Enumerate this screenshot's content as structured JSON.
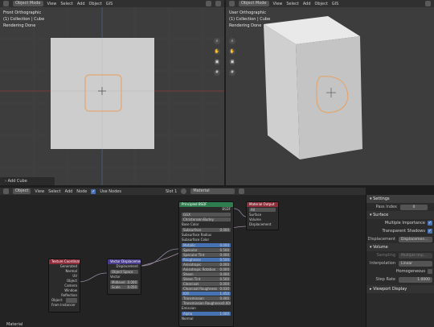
{
  "left_viewport": {
    "header": {
      "mode": "Object Mode",
      "menus": [
        "View",
        "Select",
        "Add",
        "Object",
        "GIS"
      ]
    },
    "info": [
      "Front Orthographic",
      "(1) Collection | Cube",
      "Rendering Done"
    ]
  },
  "right_viewport": {
    "header": {
      "mode": "Object Mode",
      "menus": [
        "View",
        "Select",
        "Add",
        "Object",
        "GIS"
      ]
    },
    "info": [
      "User Orthographic",
      "(1) Collection | Cube",
      "Rendering Done"
    ]
  },
  "operator_panel": {
    "label": "Add Cube"
  },
  "node_editor": {
    "header": {
      "object_mode": "Object",
      "menus": [
        "View",
        "Select",
        "Add",
        "Node"
      ],
      "use_nodes_label": "Use Nodes",
      "slot": "Slot 1",
      "material": "Material"
    },
    "material_label": "Material",
    "nodes": {
      "texcoord": {
        "title": "Texture Coordinate",
        "outputs": [
          "Generated",
          "Normal",
          "UV",
          "Object",
          "Camera",
          "Window",
          "Reflection"
        ],
        "object_label": "Object:",
        "from_instancer": "From Instancer"
      },
      "vector_disp": {
        "title": "Vector Displacement",
        "output": "Displacement",
        "space": "Object Space",
        "inputs": [
          "Vector"
        ],
        "midlevel_label": "Midlevel",
        "midlevel_value": "0.000",
        "scale_label": "Scale",
        "scale_value": "0.050"
      },
      "principled": {
        "title": "Principled BSDF",
        "output": "BSDF",
        "dist": "GGX",
        "sss": "Christensen-Burley",
        "rows": [
          {
            "label": "Base Color",
            "value": ""
          },
          {
            "label": "Subsurface",
            "value": "0.000"
          },
          {
            "label": "Subsurface Radius",
            "value": ""
          },
          {
            "label": "Subsurface Color",
            "value": ""
          },
          {
            "label": "Metallic",
            "value": "0.000"
          },
          {
            "label": "Specular",
            "value": "0.500"
          },
          {
            "label": "Specular Tint",
            "value": "0.000"
          },
          {
            "label": "Roughness",
            "value": "0.500"
          },
          {
            "label": "Anisotropic",
            "value": "0.000"
          },
          {
            "label": "Anisotropic Rotation",
            "value": "0.000"
          },
          {
            "label": "Sheen",
            "value": "0.000"
          },
          {
            "label": "Sheen Tint",
            "value": "0.500"
          },
          {
            "label": "Clearcoat",
            "value": "0.000"
          },
          {
            "label": "Clearcoat Roughness",
            "value": "0.030"
          },
          {
            "label": "IOR",
            "value": "1.450"
          },
          {
            "label": "Transmission",
            "value": "0.000"
          },
          {
            "label": "Transmission Roughness",
            "value": "0.000"
          },
          {
            "label": "Emission",
            "value": ""
          },
          {
            "label": "Alpha",
            "value": "1.000"
          },
          {
            "label": "Normal",
            "value": ""
          }
        ]
      },
      "output": {
        "title": "Material Output",
        "target": "All",
        "inputs": [
          "Surface",
          "Volume",
          "Displacement"
        ]
      }
    }
  },
  "properties": {
    "settings_title": "Settings",
    "pass_index_label": "Pass Index",
    "pass_index_value": "0",
    "surface_title": "Surface",
    "multiple_importance": "Multiple Importance",
    "transparent_shadows": "Transparent Shadows",
    "displacement_label": "Displacement",
    "displacement_value": "Displacemen...",
    "volume_title": "Volume",
    "sampling_label": "Sampling",
    "sampling_value": "Multiple Imp...",
    "interpolation_label": "Interpolation",
    "interpolation_value": "Linear",
    "homogeneous": "Homogeneous",
    "step_rate_label": "Step Rate",
    "step_rate_value": "1.0000",
    "viewport_display": "Viewport Display"
  }
}
